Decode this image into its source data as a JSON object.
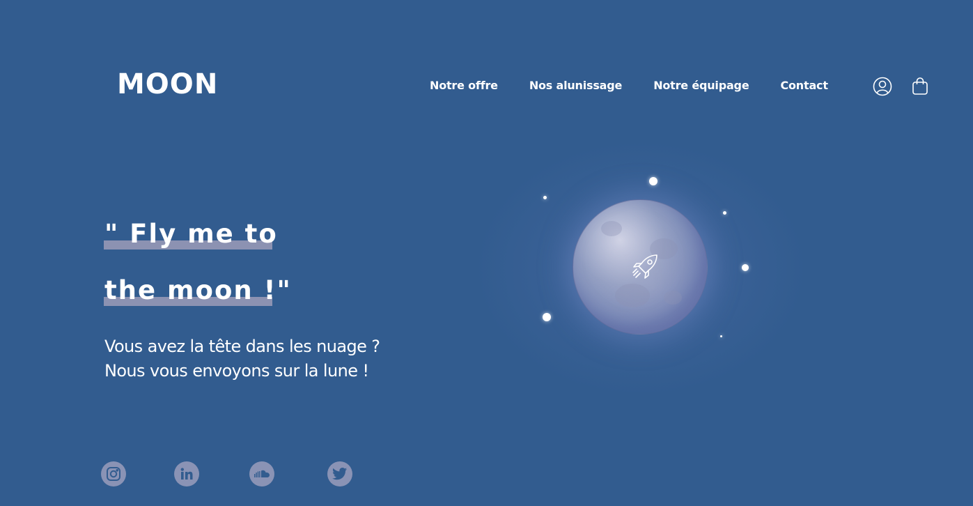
{
  "brand": {
    "logo": "MOON"
  },
  "nav": {
    "items": [
      {
        "label": "Notre offre"
      },
      {
        "label": "Nos alunissage"
      },
      {
        "label": "Notre équipage"
      },
      {
        "label": "Contact"
      }
    ]
  },
  "header_icons": [
    "user-icon",
    "shopping-bag-icon"
  ],
  "hero": {
    "line1": "\" Fly me to",
    "line2": "the moon !\"",
    "subtitle_line1": "Vous avez la tête dans les nuage ?",
    "subtitle_line2": "Nous vous envoyons sur la lune !"
  },
  "social": [
    "instagram-icon",
    "linkedin-icon",
    "soundcloud-icon",
    "twitter-icon"
  ],
  "colors": {
    "background": "#325c8f",
    "highlight": "#8c92b2",
    "social_bg": "#8a93b5",
    "text": "#ffffff"
  }
}
